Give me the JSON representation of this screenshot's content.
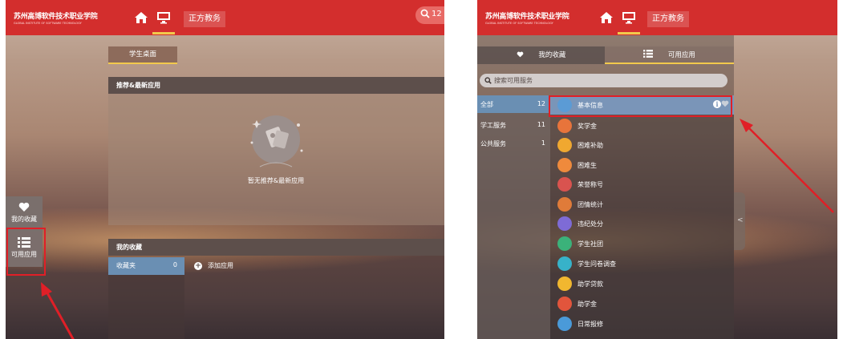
{
  "colors": {
    "topbar": "#d32e2d",
    "accent_underline": "#f2c94c",
    "selected_row": "#6a8fb3",
    "highlight": "#e01f27"
  },
  "logo": {
    "cn": "苏州高博软件技术职业学院",
    "en": "GLOBAL INSTITUTE OF SOFTWARE TECHNOLOGY"
  },
  "left": {
    "header": {
      "brand": "正方教务",
      "search_text": "12",
      "icons": [
        "home-icon",
        "desktop-icon",
        "search-icon"
      ]
    },
    "tab": "学生桌面",
    "recommend": {
      "title": "推荐&最新应用",
      "empty_text": "暂无推荐&最新应用"
    },
    "favorites": {
      "title": "我的收藏",
      "folder_label": "收藏夹",
      "folder_count": "0",
      "add_label": "添加应用"
    },
    "side": {
      "fav_label": "我的收藏",
      "apps_label": "可用应用"
    }
  },
  "right": {
    "header": {
      "brand": "正方教务",
      "icons": [
        "home-icon",
        "desktop-icon"
      ]
    },
    "tabs": {
      "favorites": "我的收藏",
      "apps": "可用应用"
    },
    "search_placeholder": "搜索可用服务",
    "categories": [
      {
        "label": "全部",
        "count": "12"
      },
      {
        "label": "学工服务",
        "count": "11"
      },
      {
        "label": "公共服务",
        "count": "1"
      }
    ],
    "apps": [
      {
        "label": "基本信息",
        "icon": "id-card-icon",
        "color": "#5b9bd5"
      },
      {
        "label": "奖学金",
        "icon": "trophy-icon",
        "color": "#e8743b"
      },
      {
        "label": "困难补助",
        "icon": "sun-icon",
        "color": "#f0a830"
      },
      {
        "label": "困难生",
        "icon": "heart-hand-icon",
        "color": "#ef8a3c"
      },
      {
        "label": "荣誉称号",
        "icon": "medal-icon",
        "color": "#d9534f"
      },
      {
        "label": "团情统计",
        "icon": "party-icon",
        "color": "#e07b39"
      },
      {
        "label": "违纪处分",
        "icon": "alert-icon",
        "color": "#7e6bd6"
      },
      {
        "label": "学生社团",
        "icon": "group-icon",
        "color": "#3bb27a"
      },
      {
        "label": "学生问卷调查",
        "icon": "survey-icon",
        "color": "#37b2c9"
      },
      {
        "label": "助学贷款",
        "icon": "loan-icon",
        "color": "#f1b72f"
      },
      {
        "label": "助学金",
        "icon": "money-icon",
        "color": "#e2553c"
      },
      {
        "label": "日常报修",
        "icon": "repair-icon",
        "color": "#4a9ad9"
      }
    ]
  }
}
